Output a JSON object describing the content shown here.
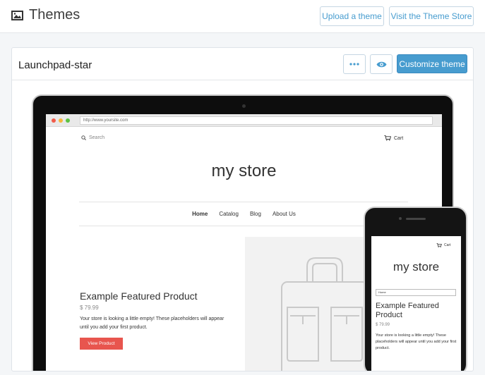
{
  "header": {
    "title": "Themes",
    "upload_label": "Upload a theme",
    "store_label": "Visit the Theme Store"
  },
  "theme": {
    "name": "Launchpad-star",
    "customize_label": "Customize theme"
  },
  "preview": {
    "url": "http://www.yoursite.com",
    "search_label": "Search",
    "cart_label": "Cart",
    "store_name": "my store",
    "nav": [
      "Home",
      "Catalog",
      "Blog",
      "About Us"
    ],
    "featured_title": "Example Featured Product",
    "price": "$ 79.99",
    "description": "Your store is looking a little empty! These placeholders will appear until you add your first product.",
    "view_button": "View Product"
  },
  "mobile": {
    "cart_label": "Cart",
    "store_name": "my store",
    "select_value": "Home",
    "featured_title": "Example Featured Product",
    "price": "$ 79.99",
    "description": "Your store is looking a little empty! These placeholders will appear until you add your first product."
  },
  "colors": {
    "accent": "#479ccf",
    "view_button": "#e8554e"
  },
  "icons": [
    "image-icon",
    "more-dots-icon",
    "eye-icon",
    "search-icon",
    "cart-icon",
    "bag-placeholder-icon"
  ]
}
